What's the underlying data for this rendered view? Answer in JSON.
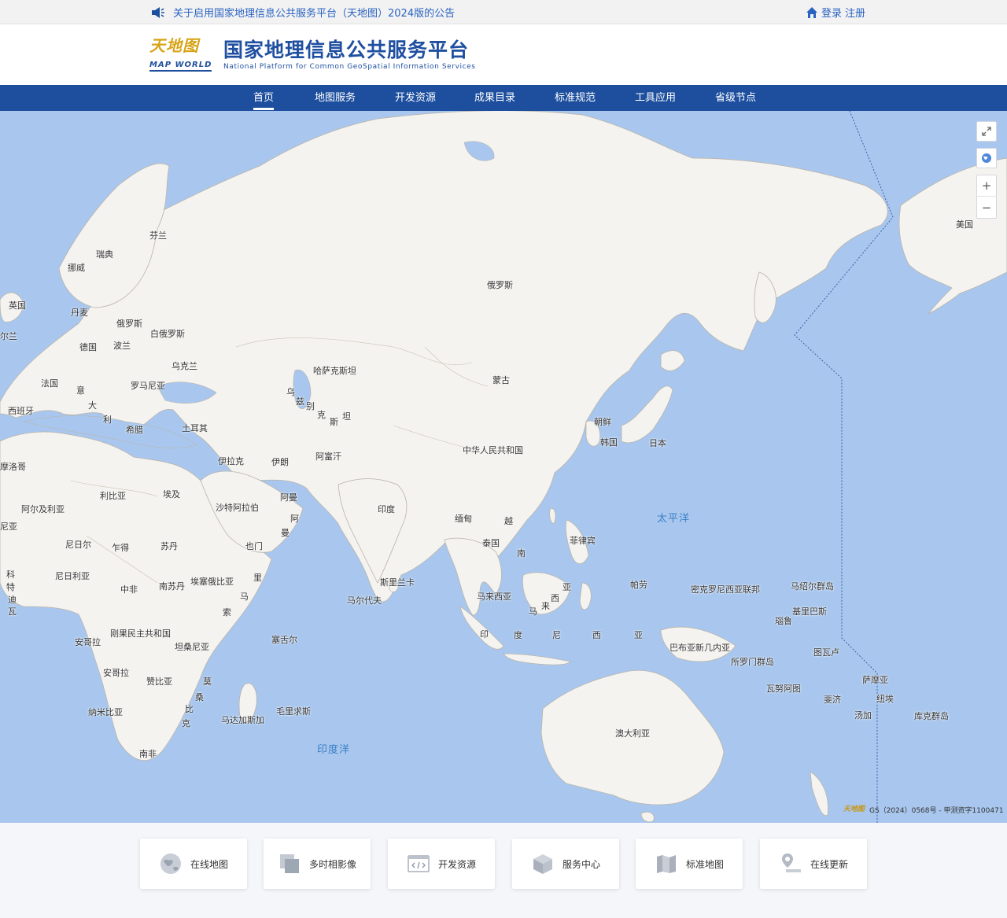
{
  "notice": {
    "text": "关于启用国家地理信息公共服务平台（天地图）2024版的公告"
  },
  "auth": {
    "login": "登录",
    "register": "注册"
  },
  "brand": {
    "logo_cn": "天地图",
    "logo_en": "MAP WORLD",
    "title": "国家地理信息公共服务平台",
    "subtitle": "National Platform for Common GeoSpatial Information Services"
  },
  "nav": [
    "首页",
    "地图服务",
    "开发资源",
    "成果目录",
    "标准规范",
    "工具应用",
    "省级节点"
  ],
  "map": {
    "oceans": [
      "太平洋",
      "印度洋"
    ],
    "labels": [
      "美国",
      "俄罗斯",
      "芬兰",
      "瑞典",
      "挪威",
      "英国",
      "丹麦",
      "尔兰",
      "俄罗斯",
      "白俄罗斯",
      "德国",
      "波兰",
      "乌克兰",
      "法国",
      "意",
      "罗马尼亚",
      "西班牙",
      "大",
      "利",
      "土耳其",
      "希腊",
      "摩洛哥",
      "哈萨克斯坦",
      "蒙古",
      "乌",
      "兹",
      "别",
      "克",
      "斯",
      "坦",
      "朝鲜",
      "韩国",
      "日本",
      "中华人民共和国",
      "伊拉克",
      "伊朗",
      "阿富汗",
      "利比亚",
      "埃及",
      "阿尔及利亚",
      "沙特阿拉伯",
      "阿曼",
      "阿",
      "曼",
      "尼亚",
      "印度",
      "缅甸",
      "越",
      "泰国",
      "南",
      "菲律宾",
      "尼日尔",
      "乍得",
      "苏丹",
      "也门",
      "科",
      "特",
      "迪",
      "瓦",
      "尼日利亚",
      "中非",
      "南苏丹",
      "埃塞俄比亚",
      "里",
      "马",
      "索",
      "斯里兰卡",
      "马尔代夫",
      "马来西亚",
      "亚",
      "西",
      "来",
      "马",
      "帕劳",
      "密克罗尼西亚联邦",
      "马绍尔群岛",
      "基里巴斯",
      "瑙鲁",
      "安哥拉",
      "刚果民主共和国",
      "坦桑尼亚",
      "塞舌尔",
      "印",
      "度",
      "尼",
      "西",
      "亚",
      "巴布亚新几内亚",
      "所罗门群岛",
      "图瓦卢",
      "安哥拉",
      "赞比亚",
      "莫",
      "桑",
      "比",
      "克",
      "马达加斯加",
      "毛里求斯",
      "纳米比亚",
      "南非",
      "澳大利亚",
      "萨摩亚",
      "瓦努阿图",
      "斐济",
      "纽埃",
      "汤加",
      "库克群岛"
    ],
    "credit": {
      "logo": "天地图",
      "text": "GS（2024）0568号 - 甲测资字1100471"
    }
  },
  "shortcuts": [
    {
      "label": "在线地图",
      "icon": "globe-icon"
    },
    {
      "label": "多时相影像",
      "icon": "layers-icon"
    },
    {
      "label": "开发资源",
      "icon": "code-window-icon"
    },
    {
      "label": "服务中心",
      "icon": "cube-icon"
    },
    {
      "label": "标准地图",
      "icon": "folded-map-icon"
    },
    {
      "label": "在线更新",
      "icon": "map-pin-icon"
    }
  ],
  "colors": {
    "nav_bg": "#1d4f9e",
    "brand_blue": "#1f4fa0",
    "link": "#2a63c2",
    "ocean": "#a9c7ee",
    "land": "#f5f3ef"
  }
}
